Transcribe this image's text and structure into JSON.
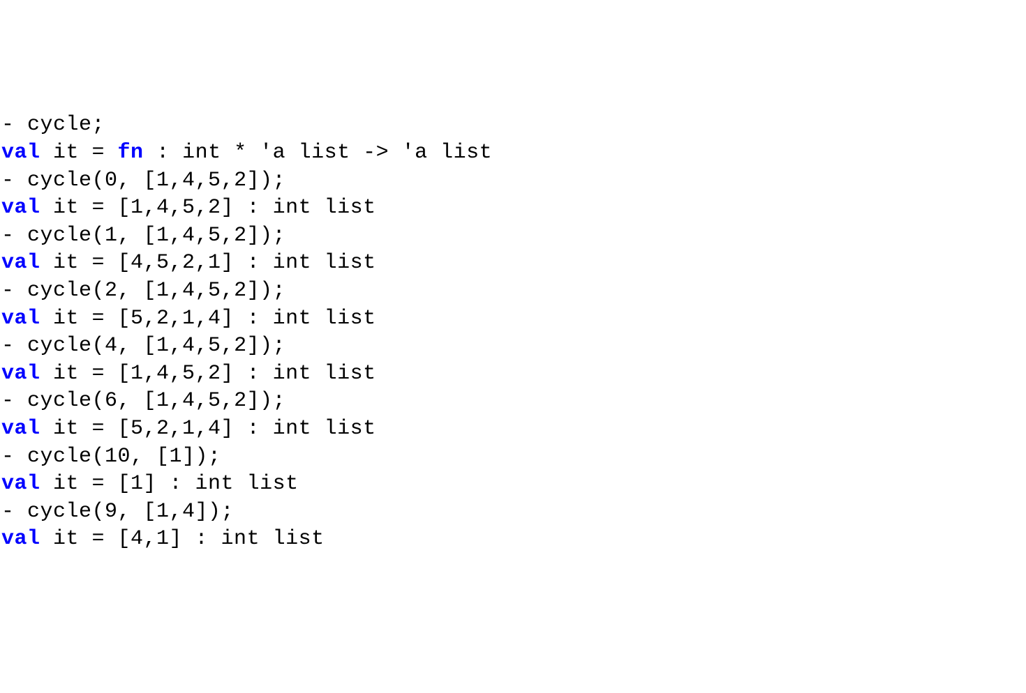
{
  "lines": [
    {
      "prefix": "- ",
      "body": "cycle;"
    },
    {
      "kw1": "val",
      "mid": " it = ",
      "kw2": "fn",
      "rest": " : int * 'a list -> 'a list"
    },
    {
      "prefix": "- ",
      "body": "cycle(0, [1,4,5,2]);"
    },
    {
      "kw1": "val",
      "rest": " it = [1,4,5,2] : int list"
    },
    {
      "prefix": "- ",
      "body": "cycle(1, [1,4,5,2]);"
    },
    {
      "kw1": "val",
      "rest": " it = [4,5,2,1] : int list"
    },
    {
      "prefix": "- ",
      "body": "cycle(2, [1,4,5,2]);"
    },
    {
      "kw1": "val",
      "rest": " it = [5,2,1,4] : int list"
    },
    {
      "prefix": "- ",
      "body": "cycle(4, [1,4,5,2]);"
    },
    {
      "kw1": "val",
      "rest": " it = [1,4,5,2] : int list"
    },
    {
      "prefix": "- ",
      "body": "cycle(6, [1,4,5,2]);"
    },
    {
      "kw1": "val",
      "rest": " it = [5,2,1,4] : int list"
    },
    {
      "prefix": "- ",
      "body": "cycle(10, [1]);"
    },
    {
      "kw1": "val",
      "rest": " it = [1] : int list"
    },
    {
      "prefix": "- ",
      "body": "cycle(9, [1,4]);"
    },
    {
      "kw1": "val",
      "rest": " it = [4,1] : int list"
    }
  ]
}
